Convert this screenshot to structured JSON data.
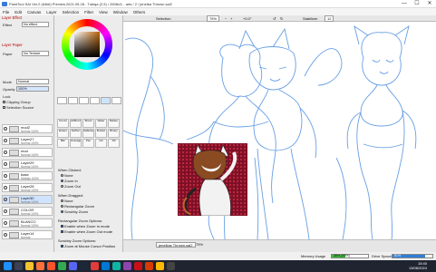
{
  "window": {
    "title": "PaintTool SAI Ver.2 (64bit) Preview.2021.05.28 - Tubiqa (2.5) / 2608x3... arts / 2 / jenelka Thrown.sai2",
    "controls": [
      "—",
      "☐",
      "✕"
    ]
  },
  "menu": [
    "File",
    "Edit",
    "Canvas",
    "Layer",
    "Selection",
    "Filter",
    "View",
    "Window",
    "Others"
  ],
  "left_panel": {
    "layer_effect_header": "Layer Effect",
    "effect_label": "Effect",
    "effect_value": "No effect",
    "layer_paper_header": "Layer Paper",
    "paper_label": "Paper",
    "paper_value": "No Texture",
    "mode_label": "Mode",
    "mode_value": "Normal",
    "opacity_label": "Opacity",
    "opacity_value": "100%",
    "lock_label": "Lock",
    "clipping_group": "Clipping Group",
    "selection_source": "Selection Source",
    "layers": [
      {
        "name": "mod2",
        "sub": "Normal 100%"
      },
      {
        "name": "Layer27",
        "sub": "Normal 100%"
      },
      {
        "name": "mod",
        "sub": "Normal 100%"
      },
      {
        "name": "Layer29",
        "sub": "Normal 100%"
      },
      {
        "name": "base",
        "sub": "Multiply 100%"
      },
      {
        "name": "Layer28",
        "sub": "Normal 100%"
      },
      {
        "name": "Layer30",
        "sub": "Normal 100%"
      },
      {
        "name": "COLOR",
        "sub": "Normal 100%"
      },
      {
        "name": "BLANCO",
        "sub": "Normal 100%"
      },
      {
        "name": "Layer14",
        "sub": "Normal"
      }
    ]
  },
  "tool_panel": {
    "brushes": [
      "Pencil",
      "AirBrush",
      "Brush",
      "Water",
      "Marker",
      "Eraser",
      "SelPen",
      "SelErase",
      "Bucket",
      "Binary",
      "Blur",
      "Smudge",
      "Pen",
      "Ink",
      "Fill"
    ],
    "when_clicked_label": "When Clicked:",
    "when_clicked": [
      "None",
      "Zoom In",
      "Zoom Out"
    ],
    "when_clicked_selected": 1,
    "when_dragged_label": "When Dragged:",
    "when_dragged": [
      "None",
      "Rectangular Zoom",
      "Scrubby Zoom"
    ],
    "when_dragged_selected": 2,
    "rect_zoom_label": "Rectangular Zoom Options:",
    "rect_zoom_opts": [
      "Enable when Zoom In mode",
      "Enable when Zoom Out mode"
    ],
    "scrubby_label": "Scrubby Zoom Options:",
    "scrubby_opts": [
      "Zoom at Mouse Cursor Position"
    ]
  },
  "canvas_toolbar": {
    "selection_label": "Selection",
    "zoom": "75%",
    "rotation": "+0.0°",
    "stabilizer_label": "Stabilizer",
    "stabilizer_value": "12"
  },
  "tabs": [
    {
      "label": "jenelkas Thrown.sai2",
      "zoom": "75%"
    }
  ],
  "status": {
    "memory_label": "Memory Usage",
    "memory_value": "38% (39%)",
    "memory_fraction": 0.38,
    "drive_label": "Drive Space",
    "drive_value": "81%",
    "drive_fraction": 0.81
  },
  "taskbar": {
    "time": "15:40",
    "date": "13/08/2024",
    "apps": [
      "start-icon",
      "search-icon",
      "folder-icon",
      "firefox-icon",
      "brave-icon",
      "chrome-icon",
      "discord-icon",
      "steam-icon",
      "paint-icon",
      "mail-icon",
      "edge-icon",
      "photos-icon",
      "opera-icon",
      "office-icon",
      "note-icon",
      "terminal-icon"
    ]
  },
  "colors": {
    "sketch": "#4d8fe0",
    "ref_bg": "#8a1630",
    "accent": "#1a6fd0"
  }
}
